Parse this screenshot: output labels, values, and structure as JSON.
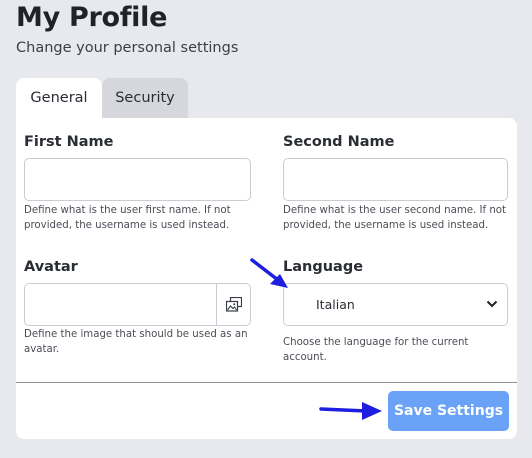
{
  "header": {
    "title": "My Profile",
    "subtitle": "Change your personal settings"
  },
  "tabs": [
    {
      "label": "General",
      "active": true
    },
    {
      "label": "Security",
      "active": false
    }
  ],
  "form": {
    "first_name": {
      "label": "First Name",
      "value": "",
      "help": "Define what is the user first name. If not provided, the username is used instead."
    },
    "second_name": {
      "label": "Second Name",
      "value": "",
      "help": "Define what is the user second name. If not provided, the username is used instead."
    },
    "avatar": {
      "label": "Avatar",
      "value": "",
      "help": "Define the image that should be used as an avatar.",
      "picker_icon": "image-picker-icon"
    },
    "language": {
      "label": "Language",
      "selected": "Italian",
      "help": "Choose the language for the current account."
    }
  },
  "footer": {
    "save_label": "Save Settings"
  },
  "colors": {
    "background": "#e8e9ee",
    "card": "#ffffff",
    "accent_button": "#69a2f6",
    "annotation_arrow": "#1d1ee0"
  }
}
